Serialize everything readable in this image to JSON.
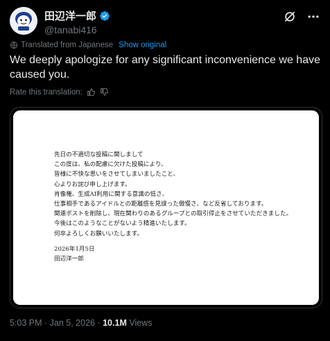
{
  "author": {
    "display_name": "田辺洋一郎",
    "handle": "@tanabi416",
    "avatar_icon": "avatar-illustration"
  },
  "translation": {
    "notice": "Translated from Japanese",
    "show_original": "Show original",
    "rate_label": "Rate this translation:"
  },
  "tweet": {
    "text": "We deeply apologize for any significant inconvenience we have caused you."
  },
  "image": {
    "lines": [
      "先日の不適切な投稿に関しまして",
      "この度は、私の配慮に欠けた投稿により、",
      "皆様に不快な思いをさせてしまいましたこと、",
      "心よりお詫び申し上げます。",
      "肖像権、生成AI利用に関する意識の低さ、",
      "仕事相手であるアイドルとの距離感を見誤った傲慢さ、など反省しております。",
      "関連ポストを削除し、現在関わりのあるグループとの取引停止をさせていただきました。",
      "今後はこのようなことがないよう精進いたします。",
      "何卒よろしくお願いいたします。"
    ],
    "date": "2026年1月5日",
    "signature": "田辺洋一郎"
  },
  "meta": {
    "timestamp": "5:03 PM · Jan 5, 2026 · ",
    "views_count": "10.1M",
    "views_label": " Views"
  },
  "colors": {
    "background": "#000000",
    "text": "#e7e9ea",
    "muted": "#71767b",
    "link": "#1d9bf0",
    "verified": "#1d9bf0",
    "border": "#2f3336"
  }
}
